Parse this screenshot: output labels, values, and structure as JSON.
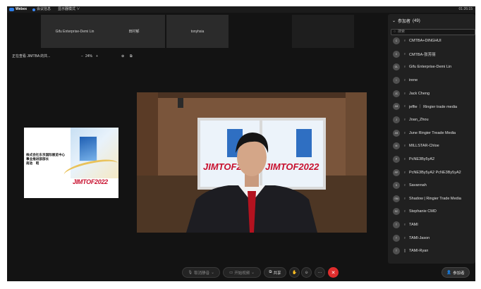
{
  "topbar": {
    "app_name": "Webex",
    "meeting_info": "会议信息",
    "layout": "显示器模式 ∨",
    "clock": "01:26:15"
  },
  "thumbnails": [
    {
      "name": "Gifu Enterprise-Demi Lin"
    },
    {
      "name": "田村郁"
    },
    {
      "name": "tonyhsia"
    },
    {
      "name": ""
    }
  ],
  "share": {
    "viewing": "正在查看 JIMTBA 的共...",
    "minus": "−",
    "zoom": "24%",
    "plus": "+",
    "icon1": "⊕",
    "icon2": "⧉"
  },
  "slide": {
    "line1": "株式会社东京国际展览中心",
    "line2": "事业推进部部长",
    "line3": "南池　昭",
    "brand": "JIMTOF2022"
  },
  "video": {
    "poster_left": "JIMTOF2022",
    "poster_right": "JIMTOF2022"
  },
  "toolbar": {
    "mute": "取消静音",
    "video": "开始视频",
    "share": "共享",
    "more": "···",
    "end": "✕",
    "participants": "参加者"
  },
  "panel": {
    "title": "参加者",
    "count": "(49)",
    "search_placeholder": "搜索",
    "participants": [
      {
        "initials": "C",
        "name": "CMTBA+DINGHUI",
        "mic": "♀"
      },
      {
        "initials": "C",
        "name": "CMTBA-张芳丽",
        "mic": "♀"
      },
      {
        "initials": "GL",
        "name": "Gifu Enterprise-Demi Lin",
        "mic": "♀"
      },
      {
        "initials": "I",
        "name": "irene",
        "mic": "♀"
      },
      {
        "initials": "JC",
        "name": "Jack Cheng",
        "mic": "♀"
      },
      {
        "initials": "JM",
        "name": "jeffie ｜ Ringier trade media",
        "mic": "♀"
      },
      {
        "initials": "J",
        "name": "Joan_Zhou",
        "mic": "♀"
      },
      {
        "initials": "JM",
        "name": "June Ringier Treade Media",
        "mic": "♀"
      },
      {
        "initials": "M",
        "name": "MILLSTAR-Chloe",
        "mic": "♀"
      },
      {
        "initials": "P",
        "name": "PcNE3By5yA2",
        "mic": "♀"
      },
      {
        "initials": "PP",
        "name": "PcNE3By5yA2 PcNE3By5yA2",
        "mic": "♀"
      },
      {
        "initials": "S",
        "name": "Savannah",
        "mic": "♀"
      },
      {
        "initials": "SM",
        "name": "Shadow | Ringier Trade Media",
        "mic": "♀"
      },
      {
        "initials": "SC",
        "name": "Stephanie CMD",
        "mic": "♀"
      },
      {
        "initials": "T",
        "name": "TAMI",
        "mic": "♀"
      },
      {
        "initials": "T",
        "name": "TAMI-Jason",
        "mic": "♀"
      },
      {
        "initials": "T",
        "name": "TAMI-Ryan",
        "mic": "▯"
      }
    ]
  },
  "colors": {
    "background": "#131313",
    "panel": "#202020",
    "accent": "#2b7de9",
    "end_call": "#e02d2d",
    "brand_red": "#c8102e"
  }
}
